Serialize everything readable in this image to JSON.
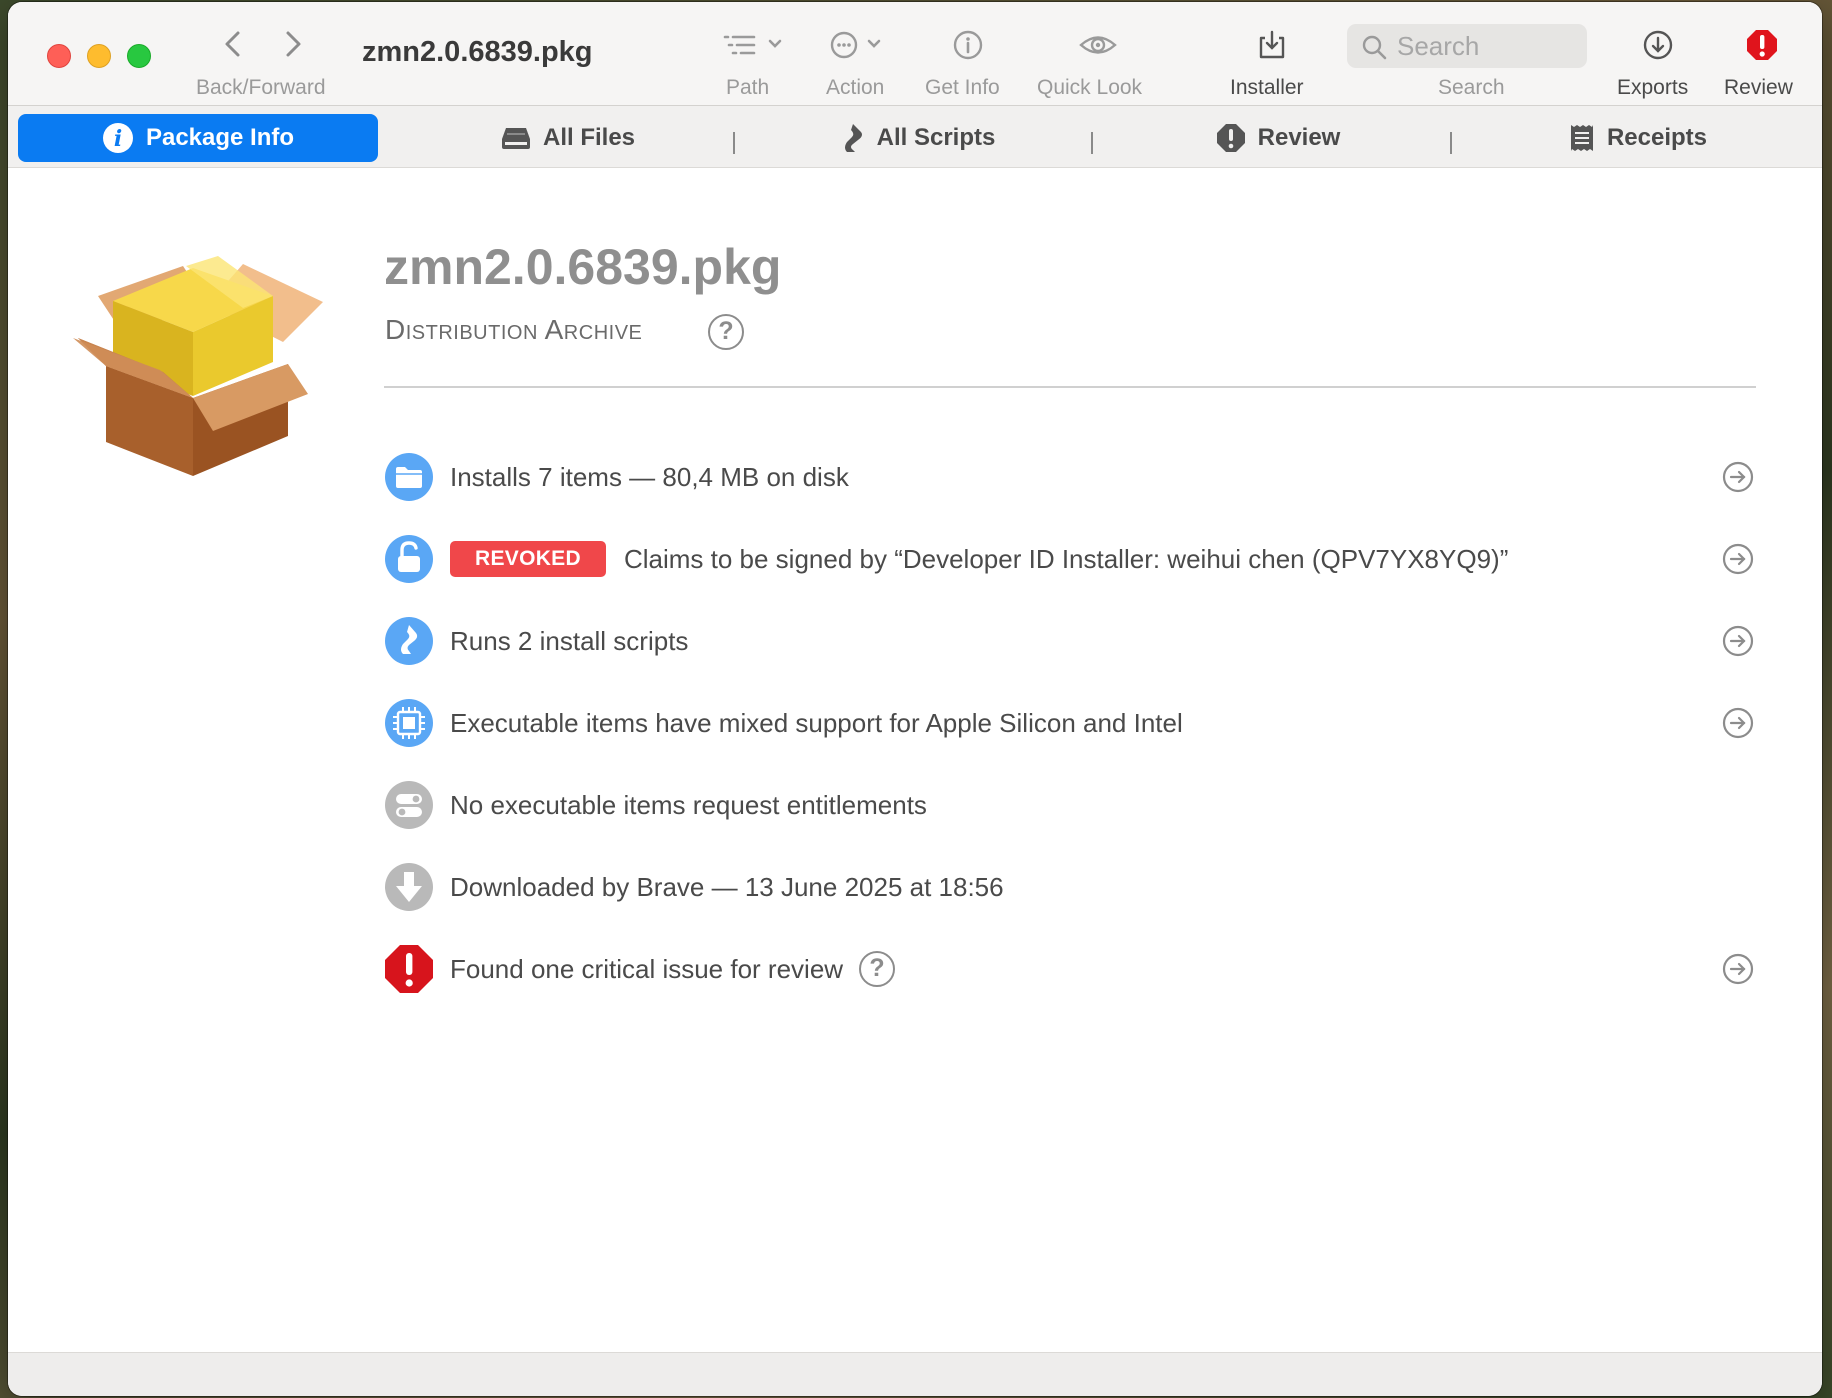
{
  "window": {
    "title": "zmn2.0.6839.pkg"
  },
  "toolbar": {
    "back_forward_label": "Back/Forward",
    "path_label": "Path",
    "action_label": "Action",
    "get_info_label": "Get Info",
    "quick_look_label": "Quick Look",
    "installer_label": "Installer",
    "search_label": "Search",
    "search_placeholder": "Search",
    "exports_label": "Exports",
    "review_label": "Review"
  },
  "tabs": [
    {
      "label": "Package Info",
      "icon": "info-icon",
      "active": true
    },
    {
      "label": "All Files",
      "icon": "drive-icon",
      "active": false
    },
    {
      "label": "All Scripts",
      "icon": "script-icon",
      "active": false
    },
    {
      "label": "Review",
      "icon": "warning-shield-icon",
      "active": false
    },
    {
      "label": "Receipts",
      "icon": "receipt-icon",
      "active": false
    }
  ],
  "package": {
    "name": "zmn2.0.6839.pkg",
    "kind": "Distribution Archive",
    "icon": "package-box-icon"
  },
  "summary": [
    {
      "icon": "folder-icon",
      "text": "Installs 7 items — 80,4 MB on disk",
      "arrow": true
    },
    {
      "icon": "unlocked-padlock-icon",
      "badge": "REVOKED",
      "text": "Claims to be signed by “Developer ID Installer: weihui chen (QPV7YX8YQ9)”",
      "arrow": true
    },
    {
      "icon": "script-icon",
      "text": "Runs 2 install scripts",
      "arrow": true
    },
    {
      "icon": "chip-icon",
      "text": "Executable items have mixed support for Apple Silicon and Intel",
      "arrow": true
    },
    {
      "icon": "toggles-icon",
      "text": "No executable items request entitlements",
      "arrow": false
    },
    {
      "icon": "download-arrow-icon",
      "text": "Downloaded by Brave — 13 June 2025 at 18:56",
      "arrow": false
    },
    {
      "icon": "critical-stop-icon",
      "text": "Found one critical issue for review",
      "help": true,
      "arrow": true
    }
  ],
  "colors": {
    "accent": "#0a7bf2",
    "revoked_badge": "#f0474a",
    "critical": "#d7141c",
    "row_icon_blue": "#5aa7f5",
    "row_icon_gray": "#b9b9b9"
  }
}
